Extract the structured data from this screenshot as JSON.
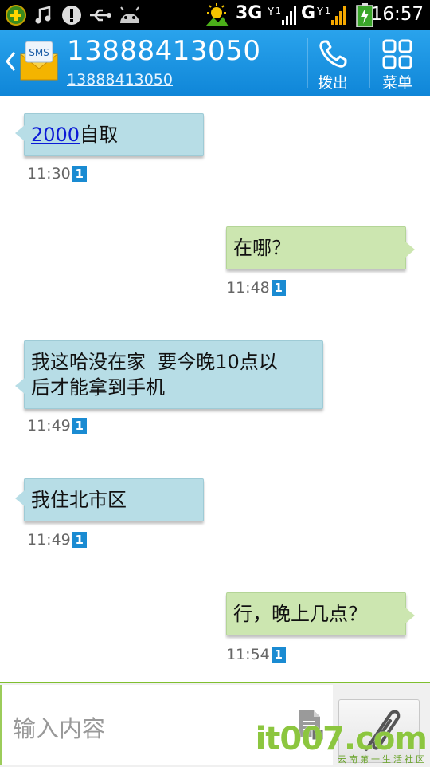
{
  "status_bar": {
    "network_3g": "3G",
    "network_g": "G",
    "clock": "16:57",
    "icons": [
      "plus-badge-icon",
      "music-note-icon",
      "alert-icon",
      "usb-icon",
      "android-icon",
      "weather-icon",
      "signal-icon",
      "battery-charging-icon"
    ]
  },
  "header": {
    "contact_name": "13888413050",
    "contact_number": "13888413050",
    "avatar_label": "SMS",
    "dial_label": "拨出",
    "menu_label": "菜单"
  },
  "messages": [
    {
      "direction": "in",
      "link_text": "2000",
      "text": "自取",
      "time": "11:30",
      "sim": "1"
    },
    {
      "direction": "out",
      "text": "在哪？",
      "time": "11:48",
      "sim": "1"
    },
    {
      "direction": "in",
      "text_line1": "我这哈没在家  要今晚10点以",
      "text_line2": "后才能拿到手机",
      "time": "11:49",
      "sim": "1"
    },
    {
      "direction": "in",
      "text": "我住北市区",
      "time": "11:49",
      "sim": "1"
    },
    {
      "direction": "out",
      "text": "行，晚上几点？",
      "time": "11:54",
      "sim": "1"
    }
  ],
  "input": {
    "placeholder": "输入内容"
  },
  "watermark": {
    "brand": "it007.com",
    "tagline": "云南第一生活社区"
  },
  "colors": {
    "header": "#1a94e0",
    "incoming_bubble": "#b7dde6",
    "outgoing_bubble": "#cce6b0",
    "sim_badge": "#1a8bd2"
  }
}
